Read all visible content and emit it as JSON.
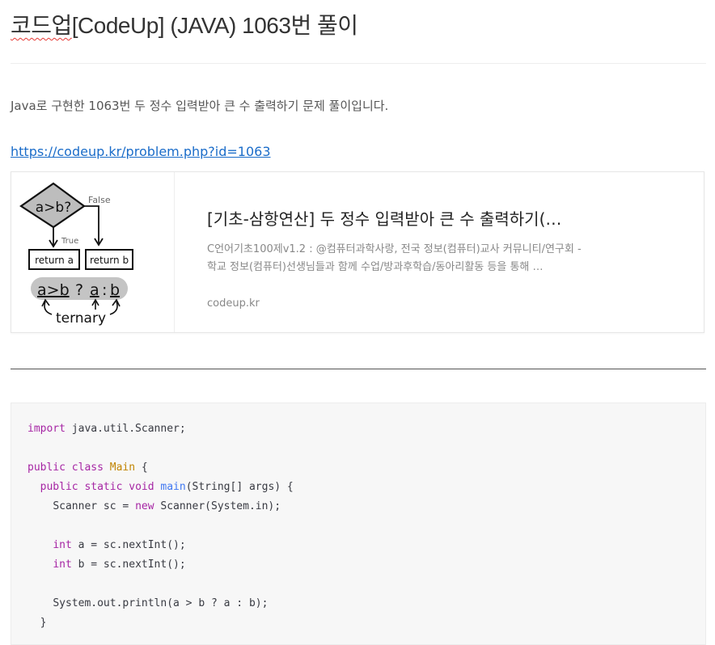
{
  "post": {
    "title_spell": "코드업",
    "title_rest": "[CodeUp] (JAVA) 1063번 풀이",
    "intro": "Java로 구현한 1063번 두 정수 입력받아 큰 수 출력하기 문제 풀이입니다.",
    "link": "https://codeup.kr/problem.php?id=1063"
  },
  "card": {
    "title": "[기초-삼항연산] 두 정수 입력받아 큰 수 출력하기(…",
    "description": "C언어기초100제v1.2 : @컴퓨터과학사랑, 전국 정보(컴퓨터)교사 커뮤니티/연구회 - 학교 정보(컴퓨터)선생님들과 함께 수업/방과후학습/동아리활동 등을 통해 …",
    "domain": "codeup.kr",
    "thumb": {
      "condition": "a>b?",
      "false_label": "False",
      "true_label": "True",
      "return_a": "return a",
      "return_b": "return b",
      "expr_cond": "a>b",
      "expr_q": "?",
      "expr_a": "a",
      "expr_colon": ":",
      "expr_b": "b",
      "caption": "ternary"
    }
  },
  "code": {
    "import_kw": "import",
    "import_rest": " java.util.Scanner;",
    "public_kw": "public",
    "class_kw": "class",
    "class_name": "Main",
    "brace_open": " {",
    "static_kw": "static",
    "void_kw": "void",
    "main_fn": "main",
    "main_params": "(String[] args) {",
    "scanner_decl": "Scanner sc = ",
    "new_kw": "new",
    "scanner_ctor": " Scanner(System.in);",
    "int_kw": "int",
    "int_a": " a = sc.nextInt();",
    "int_b": " b = sc.nextInt();",
    "println": "System.out.println(a > b ? a : b);",
    "brace_close": "}"
  }
}
